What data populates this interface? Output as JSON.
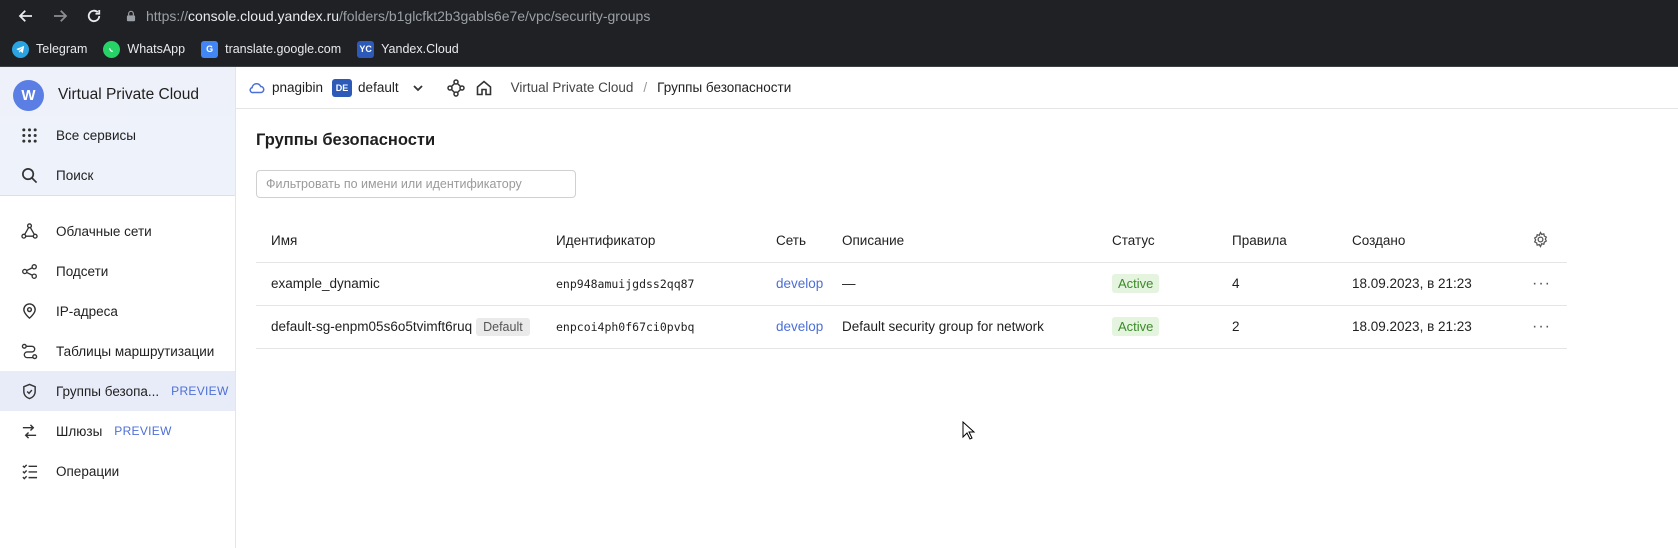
{
  "browser": {
    "url_prefix": "https://",
    "url_host": "console.cloud.yandex.ru",
    "url_path": "/folders/b1glcfkt2b3gabls6e7e/vpc/security-groups",
    "bookmarks": [
      {
        "label": "Telegram",
        "color": "#2aa3e0",
        "icon": "telegram-icon"
      },
      {
        "label": "WhatsApp",
        "color": "#25d366",
        "icon": "whatsapp-icon"
      },
      {
        "label": "translate.google.com",
        "color": "#4285f4",
        "icon": "google-translate-icon"
      },
      {
        "label": "Yandex.Cloud",
        "color": "#2d5ab8",
        "icon": "yandex-cloud-icon",
        "glyph": "YC"
      }
    ]
  },
  "sidebar": {
    "service_title": "Virtual Private Cloud",
    "service_glyph": "W",
    "top_items": [
      {
        "label": "Все сервисы",
        "icon": "grid-icon"
      },
      {
        "label": "Поиск",
        "icon": "search-icon"
      }
    ],
    "items": [
      {
        "label": "Облачные сети",
        "icon": "network-icon"
      },
      {
        "label": "Подсети",
        "icon": "subnet-icon"
      },
      {
        "label": "IP-адреса",
        "icon": "location-pin-icon"
      },
      {
        "label": "Таблицы маршрутизации",
        "icon": "route-icon"
      },
      {
        "label": "Группы безопа...",
        "icon": "shield-icon",
        "badge": "PREVIEW",
        "active": true
      },
      {
        "label": "Шлюзы",
        "icon": "gateway-icon",
        "badge": "PREVIEW"
      },
      {
        "label": "Операции",
        "icon": "list-icon"
      }
    ]
  },
  "topbar": {
    "cloud_name": "pnagibin",
    "folder_badge": "DE",
    "folder_name": "default",
    "breadcrumb_service": "Virtual Private Cloud",
    "breadcrumb_sep": "/",
    "breadcrumb_current": "Группы безопасности"
  },
  "page": {
    "title": "Группы безопасности",
    "filter_placeholder": "Фильтровать по имени или идентификатору"
  },
  "table": {
    "columns": [
      "Имя",
      "Идентификатор",
      "Сеть",
      "Описание",
      "Статус",
      "Правила",
      "Создано"
    ],
    "rows": [
      {
        "name": "example_dynamic",
        "badge": "",
        "id": "enp948amuijgdss2qq87",
        "network": "develop",
        "description": "—",
        "status": "Active",
        "rules": "4",
        "created": "18.09.2023, в 21:23",
        "menu": "···"
      },
      {
        "name": "default-sg-enpm05s6o5tvimft6ruq",
        "badge": "Default",
        "id": "enpcoi4ph0f67ci0pvbq",
        "network": "develop",
        "description": "Default security group for network",
        "status": "Active",
        "rules": "2",
        "created": "18.09.2023, в 21:23",
        "menu": "···"
      }
    ]
  }
}
